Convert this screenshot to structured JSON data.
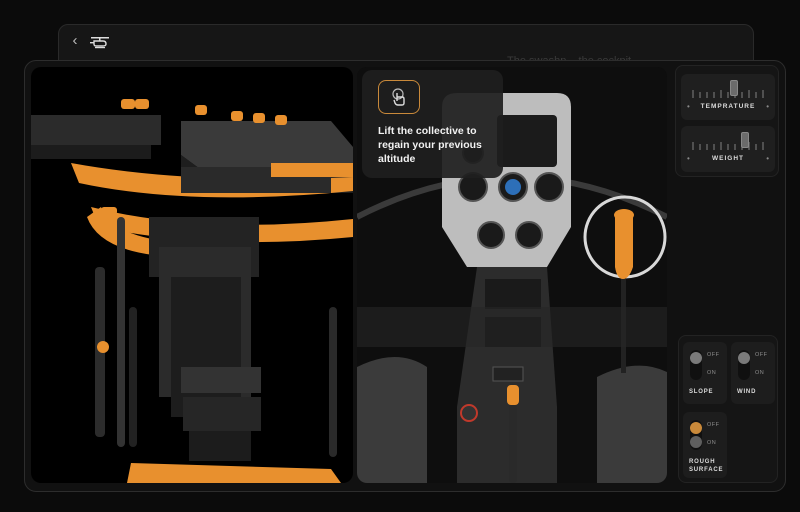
{
  "header": {
    "back_icon": "chevron-left-icon",
    "logo_icon": "helicopter-icon",
    "ghost_text": "The swashp... the cockpit"
  },
  "hint": {
    "icon": "touch-hand-icon",
    "text": "Lift the collective to regain your previous altitude",
    "accent": "#c9893a"
  },
  "sliders": [
    {
      "label": "TEMPRATURE",
      "level": 0.55
    },
    {
      "label": "WEIGHT",
      "level": 0.72
    }
  ],
  "toggles": [
    {
      "label": "SLOPE",
      "off": "OFF",
      "on": "ON",
      "state": "off"
    },
    {
      "label": "WIND",
      "off": "OFF",
      "on": "ON",
      "state": "off"
    },
    {
      "label": "ROUGH\nSURFACE",
      "off": "OFF",
      "on": "ON",
      "state": "off",
      "accent": "#c9893a"
    }
  ],
  "colors": {
    "orange": "#e8902e",
    "dark": "#1a1a1a"
  }
}
